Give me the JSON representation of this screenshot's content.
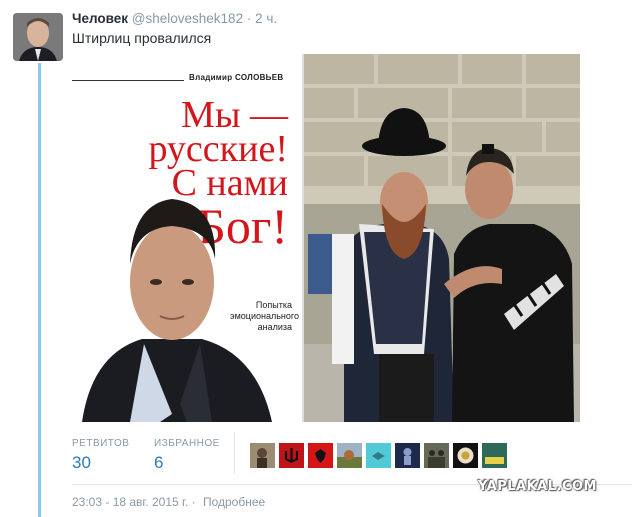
{
  "tweet": {
    "display_name": "Человек",
    "handle": "@sheloveshek182",
    "separator": "·",
    "time": "2 ч.",
    "text": "Штирлиц провалился"
  },
  "media": {
    "book_cover": {
      "author": "Владимир СОЛОВЬЕВ",
      "title_line1": "Мы — русские!",
      "title_line2": "С нами",
      "title_line3": "Бог!",
      "subtitle_line1": "Попытка",
      "subtitle_line2": "эмоционального",
      "subtitle_line3": "анализа",
      "title_color": "#d3161b"
    }
  },
  "stats": {
    "retweets_label": "РЕТВИТОВ",
    "retweets_value": "30",
    "favorites_label": "ИЗБРАННОЕ",
    "favorites_value": "6"
  },
  "favoriters": [
    {
      "icon": "avatar-figure"
    },
    {
      "icon": "avatar-trident-flag"
    },
    {
      "icon": "avatar-eagle-flag"
    },
    {
      "icon": "avatar-landscape"
    },
    {
      "icon": "avatar-cyan"
    },
    {
      "icon": "avatar-dark-figure"
    },
    {
      "icon": "avatar-soldiers"
    },
    {
      "icon": "avatar-round-emblem"
    },
    {
      "icon": "avatar-text-badge"
    }
  ],
  "meta": {
    "timestamp": "23:03 - 18 авг. 2015 г.",
    "separator": "·",
    "details_link": "Подробнее"
  },
  "watermark": "YAPLAKAL.COM",
  "colors": {
    "link": "#2b7bb9",
    "muted": "#8899a6",
    "thread_line": "#8ec8ec"
  }
}
